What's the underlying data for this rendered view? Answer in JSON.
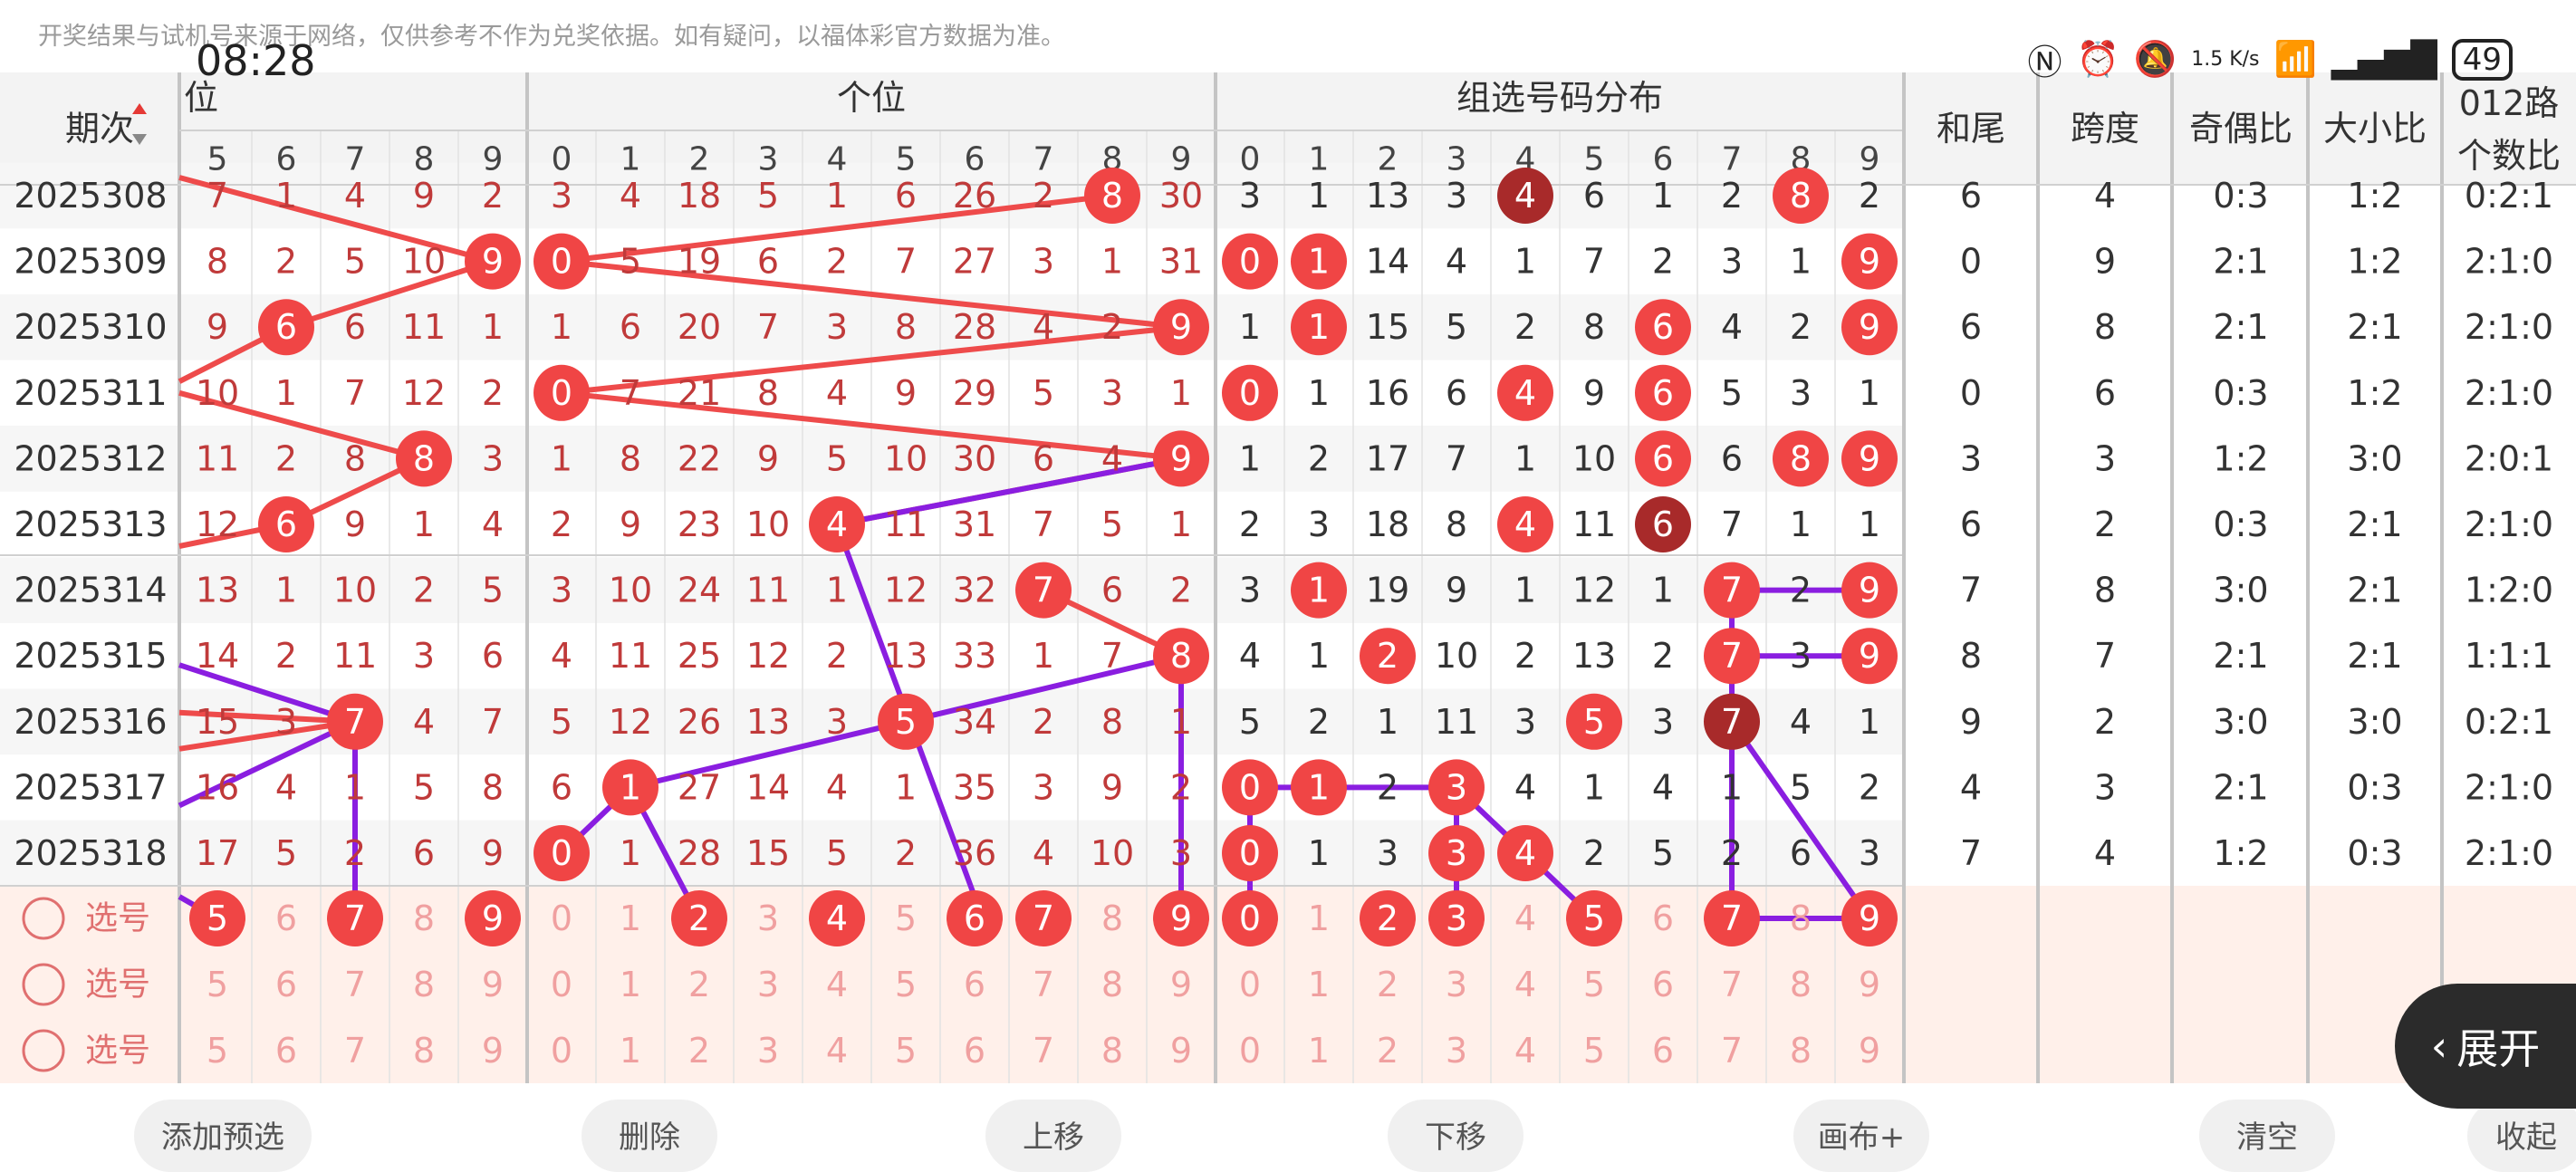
{
  "status_bar": {
    "notice": "开奖结果与试机号来源于网络，仅供参考不作为兑奖依据。如有疑问，以福体彩官方数据为准。",
    "time": "08:28",
    "net_speed": "1.5 K/s",
    "battery": "49"
  },
  "header": {
    "period_label": "期次",
    "sections": [
      "位",
      "个位",
      "组选号码分布"
    ],
    "stats": [
      "和尾",
      "跨度",
      "奇偶比",
      "大小比",
      "012路个数比"
    ],
    "digits_tens": [
      "5",
      "6",
      "7",
      "8",
      "9"
    ],
    "digits": [
      "0",
      "1",
      "2",
      "3",
      "4",
      "5",
      "6",
      "7",
      "8",
      "9"
    ]
  },
  "rows": [
    {
      "period": "2025308",
      "a": [
        "7",
        "1",
        "4",
        "9",
        "2"
      ],
      "b": [
        "3",
        "4",
        "18",
        "5",
        "1",
        "6",
        "26",
        "2",
        "8",
        "30"
      ],
      "c": [
        "3",
        "1",
        "13",
        "3",
        "4",
        "6",
        "1",
        "2",
        "8",
        "2"
      ],
      "s": [
        "6",
        "4",
        "0:3",
        "1:2",
        "0:2:1"
      ]
    },
    {
      "period": "2025309",
      "a": [
        "8",
        "2",
        "5",
        "10",
        "9"
      ],
      "b": [
        "0",
        "5",
        "19",
        "6",
        "2",
        "7",
        "27",
        "3",
        "1",
        "31"
      ],
      "c": [
        "0",
        "1",
        "14",
        "4",
        "1",
        "7",
        "2",
        "3",
        "1",
        "9"
      ],
      "s": [
        "0",
        "9",
        "2:1",
        "1:2",
        "2:1:0"
      ]
    },
    {
      "period": "2025310",
      "a": [
        "9",
        "6",
        "6",
        "11",
        "1"
      ],
      "b": [
        "1",
        "6",
        "20",
        "7",
        "3",
        "8",
        "28",
        "4",
        "2",
        "9"
      ],
      "c": [
        "1",
        "1",
        "15",
        "5",
        "2",
        "8",
        "6",
        "4",
        "2",
        "9"
      ],
      "s": [
        "6",
        "8",
        "2:1",
        "2:1",
        "2:1:0"
      ]
    },
    {
      "period": "2025311",
      "a": [
        "10",
        "1",
        "7",
        "12",
        "2"
      ],
      "b": [
        "0",
        "7",
        "21",
        "8",
        "4",
        "9",
        "29",
        "5",
        "3",
        "1"
      ],
      "c": [
        "0",
        "1",
        "16",
        "6",
        "4",
        "9",
        "6",
        "5",
        "3",
        "1"
      ],
      "s": [
        "0",
        "6",
        "0:3",
        "1:2",
        "2:1:0"
      ]
    },
    {
      "period": "2025312",
      "a": [
        "11",
        "2",
        "8",
        "8",
        "3"
      ],
      "b": [
        "1",
        "8",
        "22",
        "9",
        "5",
        "10",
        "30",
        "6",
        "4",
        "9"
      ],
      "c": [
        "1",
        "2",
        "17",
        "7",
        "1",
        "10",
        "6",
        "6",
        "8",
        "9"
      ],
      "s": [
        "3",
        "3",
        "1:2",
        "3:0",
        "2:0:1"
      ]
    },
    {
      "period": "2025313",
      "a": [
        "12",
        "6",
        "9",
        "1",
        "4"
      ],
      "b": [
        "2",
        "9",
        "23",
        "10",
        "4",
        "11",
        "31",
        "7",
        "5",
        "1"
      ],
      "c": [
        "2",
        "3",
        "18",
        "8",
        "4",
        "11",
        "6",
        "7",
        "1",
        "1"
      ],
      "s": [
        "6",
        "2",
        "0:3",
        "2:1",
        "2:1:0"
      ]
    },
    {
      "period": "2025314",
      "a": [
        "13",
        "1",
        "10",
        "2",
        "5"
      ],
      "b": [
        "3",
        "10",
        "24",
        "11",
        "1",
        "12",
        "32",
        "7",
        "6",
        "2"
      ],
      "c": [
        "3",
        "1",
        "19",
        "9",
        "1",
        "12",
        "1",
        "7",
        "2",
        "9"
      ],
      "s": [
        "7",
        "8",
        "3:0",
        "2:1",
        "1:2:0"
      ]
    },
    {
      "period": "2025315",
      "a": [
        "14",
        "2",
        "11",
        "3",
        "6"
      ],
      "b": [
        "4",
        "11",
        "25",
        "12",
        "2",
        "13",
        "33",
        "1",
        "7",
        "8"
      ],
      "c": [
        "4",
        "1",
        "2",
        "10",
        "2",
        "13",
        "2",
        "7",
        "3",
        "9"
      ],
      "s": [
        "8",
        "7",
        "2:1",
        "2:1",
        "1:1:1"
      ]
    },
    {
      "period": "2025316",
      "a": [
        "15",
        "3",
        "7",
        "4",
        "7"
      ],
      "b": [
        "5",
        "12",
        "26",
        "13",
        "3",
        "5",
        "34",
        "2",
        "8",
        "1"
      ],
      "c": [
        "5",
        "2",
        "1",
        "11",
        "3",
        "5",
        "3",
        "7",
        "4",
        "1"
      ],
      "s": [
        "9",
        "2",
        "3:0",
        "3:0",
        "0:2:1"
      ]
    },
    {
      "period": "2025317",
      "a": [
        "16",
        "4",
        "1",
        "5",
        "8"
      ],
      "b": [
        "6",
        "1",
        "27",
        "14",
        "4",
        "1",
        "35",
        "3",
        "9",
        "2"
      ],
      "c": [
        "0",
        "1",
        "2",
        "3",
        "4",
        "1",
        "4",
        "1",
        "5",
        "2"
      ],
      "s": [
        "4",
        "3",
        "2:1",
        "0:3",
        "2:1:0"
      ]
    },
    {
      "period": "2025318",
      "a": [
        "17",
        "5",
        "2",
        "6",
        "9"
      ],
      "b": [
        "0",
        "1",
        "28",
        "15",
        "5",
        "2",
        "36",
        "4",
        "10",
        "3"
      ],
      "c": [
        "0",
        "1",
        "3",
        "3",
        "4",
        "2",
        "5",
        "2",
        "6",
        "3"
      ],
      "s": [
        "7",
        "4",
        "1:2",
        "0:3",
        "2:1:0"
      ]
    }
  ],
  "hits": [
    {
      "a": [],
      "b": [
        8
      ],
      "c": [
        {
          "i": 4,
          "dark": true
        },
        {
          "i": 8
        }
      ]
    },
    {
      "a": [
        4
      ],
      "b": [
        0
      ],
      "c": [
        {
          "i": 0
        },
        {
          "i": 1
        },
        {
          "i": 9
        }
      ]
    },
    {
      "a": [
        1
      ],
      "b": [
        9
      ],
      "c": [
        {
          "i": 1
        },
        {
          "i": 6
        },
        {
          "i": 9
        }
      ]
    },
    {
      "a": [],
      "b": [
        0
      ],
      "c": [
        {
          "i": 0
        },
        {
          "i": 4
        },
        {
          "i": 6
        }
      ]
    },
    {
      "a": [
        3
      ],
      "b": [
        9
      ],
      "c": [
        {
          "i": 6
        },
        {
          "i": 8
        },
        {
          "i": 9
        }
      ]
    },
    {
      "a": [
        1
      ],
      "b": [
        4
      ],
      "c": [
        {
          "i": 4
        },
        {
          "i": 6,
          "dark": true
        }
      ]
    },
    {
      "a": [],
      "b": [
        7
      ],
      "c": [
        {
          "i": 1
        },
        {
          "i": 7
        },
        {
          "i": 9
        }
      ]
    },
    {
      "a": [],
      "b": [
        9
      ],
      "c": [
        {
          "i": 2
        },
        {
          "i": 7
        },
        {
          "i": 9
        }
      ]
    },
    {
      "a": [
        2
      ],
      "b": [
        5
      ],
      "c": [
        {
          "i": 5
        },
        {
          "i": 7,
          "dark": true
        }
      ]
    },
    {
      "a": [],
      "b": [
        1
      ],
      "c": [
        {
          "i": 0
        },
        {
          "i": 1
        },
        {
          "i": 3
        }
      ]
    },
    {
      "a": [],
      "b": [
        0
      ],
      "c": [
        {
          "i": 0
        },
        {
          "i": 3
        },
        {
          "i": 4
        }
      ]
    }
  ],
  "selection": {
    "label": "选号",
    "rows": [
      {
        "a": [
          0,
          2,
          4
        ],
        "b": [
          2,
          4,
          6,
          7,
          9
        ],
        "c": [
          0,
          2,
          3,
          5,
          7,
          9
        ]
      },
      {
        "a": [],
        "b": [],
        "c": []
      },
      {
        "a": [],
        "b": [],
        "c": []
      }
    ]
  },
  "buttons": {
    "expand": "展开",
    "toolbar": [
      "添加预选",
      "删除",
      "上移",
      "下移",
      "画布+",
      "清空",
      "收起"
    ]
  },
  "colors": {
    "red": "#f04545",
    "dark_red": "#a82a2a",
    "purple": "#8a1ee0",
    "line_red": "#ee4b4b",
    "text_red": "#c03a3a"
  }
}
